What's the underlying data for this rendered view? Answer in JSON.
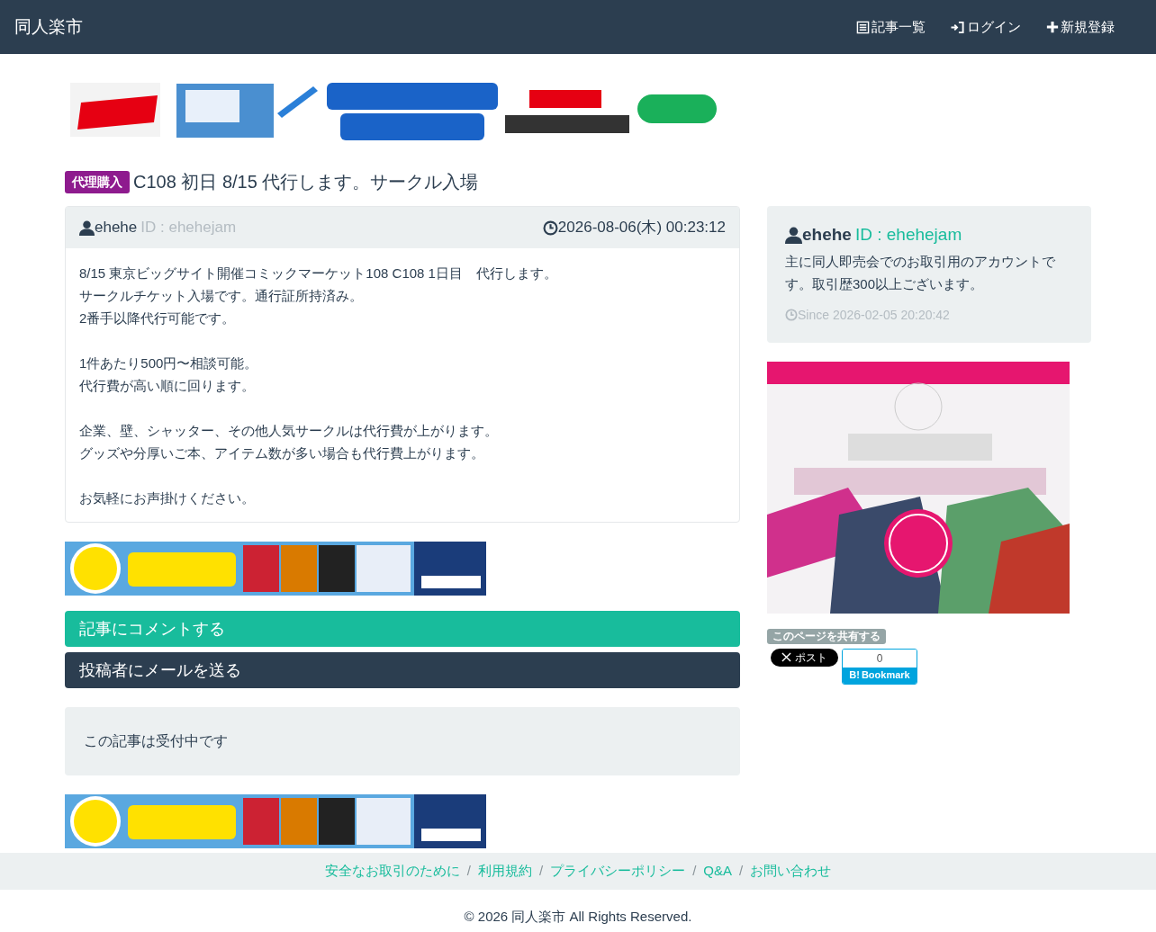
{
  "navbar": {
    "brand": "同人楽市",
    "links": [
      {
        "kind": "list",
        "label": "記事一覧"
      },
      {
        "kind": "login",
        "label": "ログイン"
      },
      {
        "kind": "signup",
        "label": "新規登録"
      }
    ]
  },
  "article": {
    "category": "代理購入",
    "title": "C108 初日 8/15 代行します。サークル入場",
    "author": "ehehe",
    "author_id": "ID : ehehejam",
    "posted": "2026-08-06(木) 00:23:12",
    "paragraphs": [
      [
        "8/15 東京ビッグサイト開催コミックマーケット108 C108 1日目　代行します。",
        "サークルチケット入場です。通行証所持済み。",
        "2番手以降代行可能です。"
      ],
      [
        "1件あたり500円〜相談可能。",
        "代行費が高い順に回ります。"
      ],
      [
        "企業、壁、シャッター、その他人気サークルは代行費が上がります。",
        "グッズや分厚いご本、アイテム数が多い場合も代行費上がります。"
      ],
      [
        "お気軽にお声掛けください。"
      ]
    ]
  },
  "buttons": [
    {
      "kind": "primary",
      "label": "記事にコメントする"
    },
    {
      "kind": "dark",
      "label": "投稿者にメールを送る"
    }
  ],
  "status_notice": "この記事は受付中です",
  "profile": {
    "name": "ehehe",
    "id": "ID : ehehejam",
    "bio": "主に同人即売会でのお取引用のアカウントです。取引歴300以上ございます。",
    "since": "Since 2026-02-05 20:20:42"
  },
  "share": {
    "label": "このページを共有する",
    "x_button": "ポスト",
    "bookmark_count": "0",
    "bookmark_label": "Bookmark",
    "bookmark_logo": "B!"
  },
  "footer": {
    "separator": "/",
    "links": [
      "安全なお取引のために",
      "利用規約",
      "プライバシーポリシー",
      "Q&A",
      "お問い合わせ"
    ],
    "copyright": "© 2026 同人楽市 All Rights Reserved."
  }
}
